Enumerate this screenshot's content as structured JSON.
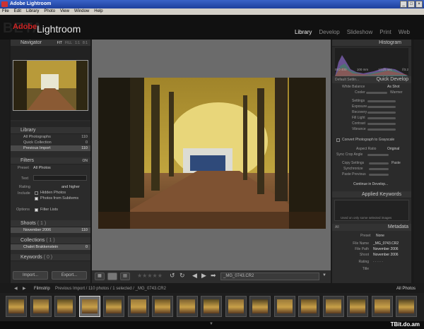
{
  "window": {
    "title": "Adobe Lightroom",
    "controls": [
      "_",
      "□",
      "×"
    ]
  },
  "menubar": [
    "File",
    "Edit",
    "Library",
    "Photo",
    "View",
    "Window",
    "Help"
  ],
  "header": {
    "brand_text": "BETA",
    "app_name": "Lightroom",
    "modules": [
      "Library",
      "Develop",
      "Slideshow",
      "Print",
      "Web"
    ],
    "active_module": "Library"
  },
  "navigator": {
    "title": "Navigator",
    "zoom": [
      "FIT",
      "FILL",
      "1:1",
      "8:1"
    ]
  },
  "library": {
    "title": "Library",
    "items": [
      {
        "label": "All Photographs",
        "count": "110"
      },
      {
        "label": "Quick Collection",
        "count": "0"
      },
      {
        "label": "Previous Import",
        "count": "110"
      }
    ]
  },
  "filters": {
    "title": "Filters",
    "toggle": "ON",
    "preset_label": "Preset",
    "preset_value": "All Photos",
    "text_label": "Text",
    "rating_label": "Rating",
    "rating_suffix": "and higher",
    "include_label": "Include",
    "hidden_photos": "Hidden Photos",
    "from_subitems": "Photos from Subitems",
    "options_label": "Options",
    "filter_lists": "Filter Lists"
  },
  "shoots": {
    "title": "Shoots",
    "count": "( 1 )",
    "items": [
      {
        "label": "November 2006",
        "count": "110"
      }
    ]
  },
  "collections": {
    "title": "Collections",
    "count": "( 1 )",
    "items": [
      {
        "label": "Chalet Brakkenstein",
        "count": "0"
      }
    ]
  },
  "keywords": {
    "title": "Keywords",
    "count": "( 0 )"
  },
  "left_buttons": {
    "import": "Import...",
    "export": "Export..."
  },
  "histogram": {
    "title": "Histogram",
    "iso": "ISO 400",
    "focal": "100 mm",
    "shutter": "1/125 sec",
    "aperture": "f/3.2"
  },
  "quick_develop": {
    "title": "Quick Develop",
    "preset": "Default Settin...",
    "white_balance_label": "White Balance",
    "white_balance_value": "As Shot",
    "cooler": "Cooler",
    "warmer": "Warmer",
    "rows": [
      "Settings",
      "Exposure",
      "Recovery",
      "Fill Light",
      "Contrast",
      "Vibrance"
    ],
    "convert": "Convert Photograph to Grayscale",
    "aspect_label": "Aspect Ratio",
    "aspect_value": "Original",
    "sync_crop": "Sync Crop Angle",
    "copy_settings": "Copy Settings",
    "paste": "Paste",
    "synchronize": "Synchronize",
    "paste_previous": "Paste Previous",
    "continue": "Continue in Develop..."
  },
  "keywording": {
    "title": "Applied Keywords",
    "hint": "Used on only some selected images"
  },
  "metadata": {
    "title": "Metadata",
    "all_label": "All",
    "preset_label": "Preset",
    "preset_value": "None",
    "fields": [
      {
        "label": "File Name",
        "value": "_MG_0743.CR2"
      },
      {
        "label": "File Path",
        "value": "November 2006"
      },
      {
        "label": "Shoot",
        "value": "November 2006"
      },
      {
        "label": "Rating",
        "value": "· · · · ·"
      },
      {
        "label": "Title",
        "value": ""
      }
    ]
  },
  "toolbar": {
    "filename": "_MG_0743.CR2",
    "stars": "★★★★★"
  },
  "filmstrip": {
    "label": "Filmstrip",
    "path": "Previous Import / 110 photos / 1 selected / _MG_0743.CR2",
    "filter": "All Photos",
    "thumb_count": 17
  },
  "watermark": "TBit.do.am"
}
